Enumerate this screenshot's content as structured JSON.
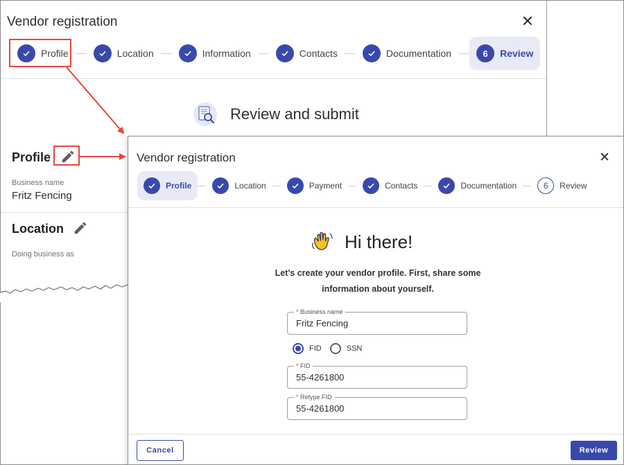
{
  "background_dialog": {
    "title": "Vendor registration",
    "close_icon": "close-icon",
    "steps": [
      {
        "label": "Profile",
        "state": "complete"
      },
      {
        "label": "Location",
        "state": "complete"
      },
      {
        "label": "Information",
        "state": "complete"
      },
      {
        "label": "Contacts",
        "state": "complete"
      },
      {
        "label": "Documentation",
        "state": "complete"
      },
      {
        "label": "Review",
        "state": "active",
        "number": "6"
      }
    ],
    "review_heading": "Review and submit",
    "review_icon": "document-search-icon",
    "sections": {
      "profile": {
        "title": "Profile",
        "edit_icon": "pencil-icon",
        "field_label": "Business name",
        "field_value": "Fritz Fencing"
      },
      "location": {
        "title": "Location",
        "edit_icon": "pencil-icon",
        "field_label": "Doing business as"
      }
    }
  },
  "foreground_dialog": {
    "title": "Vendor registration",
    "close_icon": "close-icon",
    "steps": [
      {
        "label": "Profile",
        "state": "active"
      },
      {
        "label": "Location",
        "state": "complete"
      },
      {
        "label": "Payment",
        "state": "complete"
      },
      {
        "label": "Contacts",
        "state": "complete"
      },
      {
        "label": "Documentation",
        "state": "complete"
      },
      {
        "label": "Review",
        "state": "upcoming",
        "number": "6"
      }
    ],
    "greeting": "Hi there!",
    "greeting_icon": "waving-hand-icon",
    "intro_line1": "Let's create your vendor profile. First, share some",
    "intro_line2": "information about yourself.",
    "business_name": {
      "label": "Business name",
      "value": "Fritz Fencing",
      "required_mark": "*"
    },
    "tax_id_type": {
      "options": [
        {
          "label": "FID",
          "selected": true
        },
        {
          "label": "SSN",
          "selected": false
        }
      ]
    },
    "fid": {
      "label": "FID",
      "value": "55-4261800",
      "required_mark": "*"
    },
    "retype_fid": {
      "label": "Retype FID",
      "value": "55-4261800",
      "required_mark": "*"
    },
    "cancel_label": "Cancel",
    "review_label": "Review"
  },
  "colors": {
    "primary": "#3949ab",
    "primary_light": "#e8eaf6",
    "annotation": "#e8453c",
    "required": "#e53935"
  }
}
